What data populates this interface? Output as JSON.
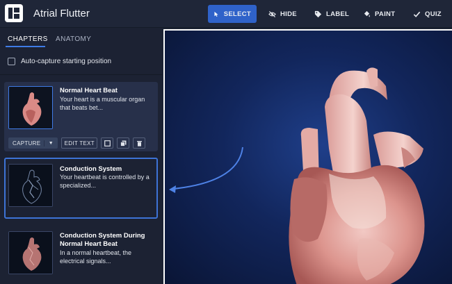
{
  "app": {
    "title": "Atrial Flutter"
  },
  "toolbar": {
    "select_label": "SELECT",
    "hide_label": "HIDE",
    "label_label": "LABEL",
    "paint_label": "PAINT",
    "quiz_label": "QUIZ",
    "active_tool": "select",
    "accent_color": "#2f62c9"
  },
  "tabs": [
    {
      "label": "CHAPTERS",
      "active": true
    },
    {
      "label": "ANATOMY",
      "active": false
    }
  ],
  "autocapture": {
    "label": "Auto-capture starting position",
    "checked": false
  },
  "chapters": [
    {
      "title": "Normal Heart Beat",
      "description": "Your heart is a muscular organ that beats bet...",
      "selected": true
    },
    {
      "title": "Conduction System",
      "description": "Your heartbeat is controlled by a specialized...",
      "highlighted": true
    },
    {
      "title": "Conduction System During Normal Heart Beat",
      "description": "In a normal heartbeat, the electrical signals..."
    }
  ],
  "chapter_actions": {
    "capture_label": "CAPTURE",
    "edit_text_label": "EDIT TEXT"
  },
  "icons": {
    "select": "cursor-icon",
    "hide": "eye-slash-icon",
    "label": "tag-icon",
    "paint": "paint-bucket-icon",
    "quiz": "check-icon"
  }
}
